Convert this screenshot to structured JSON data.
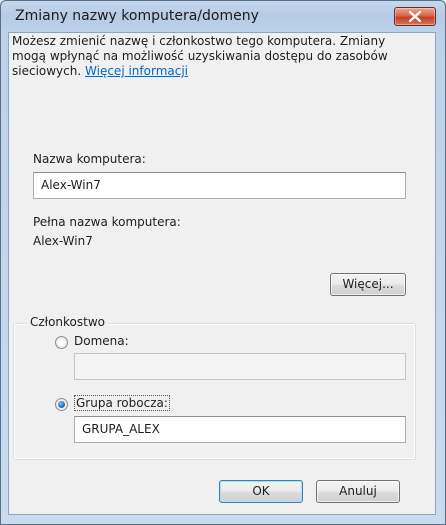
{
  "window": {
    "title": "Zmiany nazwy komputera/domeny",
    "close_icon": "close-icon"
  },
  "description": {
    "text": "Możesz zmienić nazwę i członkostwo tego komputera. Zmiany mogą wpłynąć na możliwość uzyskiwania dostępu do zasobów sieciowych.",
    "link": "Więcej informacji"
  },
  "computer_name": {
    "label": "Nazwa komputera:",
    "value": "Alex-Win7"
  },
  "full_name": {
    "label": "Pełna nazwa komputera:",
    "value": "Alex-Win7"
  },
  "more_button": "Więcej...",
  "membership": {
    "legend": "Członkostwo",
    "domain": {
      "label": "Domena:",
      "selected": false,
      "value": ""
    },
    "workgroup": {
      "label": "Grupa robocza:",
      "selected": true,
      "value": "GRUPA_ALEX"
    }
  },
  "buttons": {
    "ok": "OK",
    "cancel": "Anuluj"
  },
  "colors": {
    "title_bar": "#c4d7ee",
    "close_button": "#c9482c",
    "link": "#0066cc",
    "radio_selected": "#1a6fc2"
  }
}
